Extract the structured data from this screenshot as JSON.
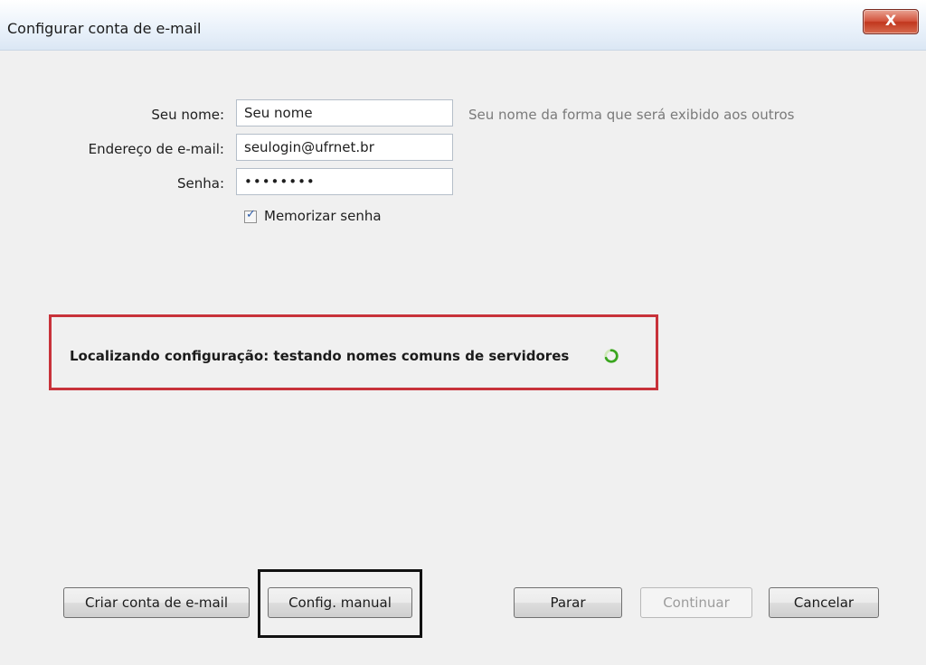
{
  "window": {
    "title": "Configurar conta de e-mail",
    "close_label": "X"
  },
  "form": {
    "name_label": "Seu nome:",
    "name_value": "Seu nome",
    "name_hint": "Seu nome da forma que será exibido aos outros",
    "email_label": "Endereço de e-mail:",
    "email_value": "seulogin@ufrnet.br",
    "password_label": "Senha:",
    "password_value": "••••••••",
    "remember_label": "Memorizar senha",
    "remember_checked": true
  },
  "status": {
    "text": "Localizando configuração: testando nomes comuns de servidores",
    "icon": "spinner-icon",
    "highlight_color": "#c8323a"
  },
  "buttons": {
    "create": "Criar conta de e-mail",
    "manual": "Config. manual",
    "stop": "Parar",
    "continue": "Continuar",
    "cancel": "Cancelar"
  }
}
